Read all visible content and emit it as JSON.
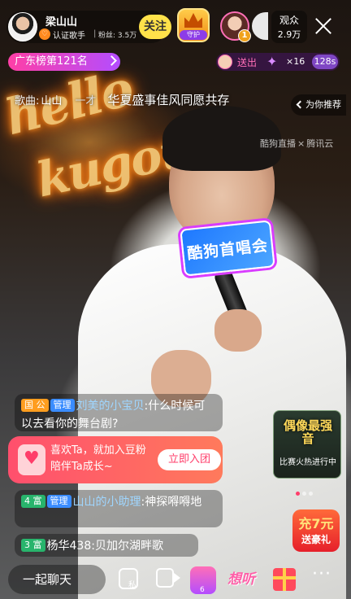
{
  "host": {
    "name": "梁山山",
    "badge": "♡",
    "certification": "认证歌手",
    "separator": "|",
    "fans": "粉丝: 3.5万",
    "follow_label": "关注"
  },
  "guard": {
    "label": "守护"
  },
  "viewer": {
    "rank": "1"
  },
  "audience": {
    "label": "观众",
    "count": "2.9万"
  },
  "rank_pill": {
    "label": "广东榜第121名"
  },
  "gift_strip": {
    "action": "送出",
    "multiplier": "×16",
    "seconds": "128s"
  },
  "song": {
    "label": "歌曲:",
    "title": "山山",
    "dash": "一才",
    "lyric": "华夏盛事佳风同愿共存"
  },
  "recommend": {
    "label": "为你推荐"
  },
  "watermark": {
    "left": "酷狗直播",
    "sep": "×",
    "right": "腾讯云"
  },
  "stage_text": {
    "neon_line1": "hello",
    "neon_line2": "kugou",
    "mic_flag": "酷狗首唱会"
  },
  "chat_messages": [
    {
      "tags": [
        {
          "type": "guo",
          "label": "国 公"
        },
        {
          "type": "admin",
          "label": "管理"
        }
      ],
      "user": "刘美的小宝贝",
      "text": ":什么时候可以去看你的舞台剧?"
    },
    {
      "tags": [
        {
          "type": "rich",
          "label": "4 富"
        },
        {
          "type": "admin",
          "label": "管理"
        }
      ],
      "user": "山山的小助理",
      "text": ":神探嘚嘚地"
    },
    {
      "tags": [
        {
          "type": "rich",
          "label": "3 富"
        }
      ],
      "user": "杨华438",
      "text": ":贝加尔湖畔歌"
    }
  ],
  "promo": {
    "text": "喜欢Ta，就加入豆粉陪伴Ta成长~",
    "button": "立即入团"
  },
  "event_card": {
    "title": "偶像最强音",
    "subtitle": "比赛火热进行中"
  },
  "recharge": {
    "top": "充7元",
    "bottom": "送豪礼"
  },
  "bottom_bar": {
    "chat_placeholder": "一起聊天",
    "dm_label": "私",
    "gift_count": "6",
    "hear_label": "想听",
    "more": "···"
  },
  "icons": [
    "host-avatar",
    "heart-badge-icon",
    "crown-icon",
    "close-icon",
    "chevron-right-icon",
    "star-gift-icon",
    "chevron-left-icon",
    "shield-heart-icon",
    "private-message-icon",
    "video-icon",
    "gift-box-icon",
    "present-icon",
    "more-icon"
  ],
  "colors": {
    "follow_button": "#ffe24a",
    "rank_pill_start": "#ff3fa6",
    "rank_pill_end": "#b34dff",
    "promo_start": "#ff4f6d",
    "promo_end": "#ff7a5c",
    "admin_tag": "#3a8cff",
    "rich_tag": "#28b46c",
    "guo_tag": "#ff9d1f"
  }
}
